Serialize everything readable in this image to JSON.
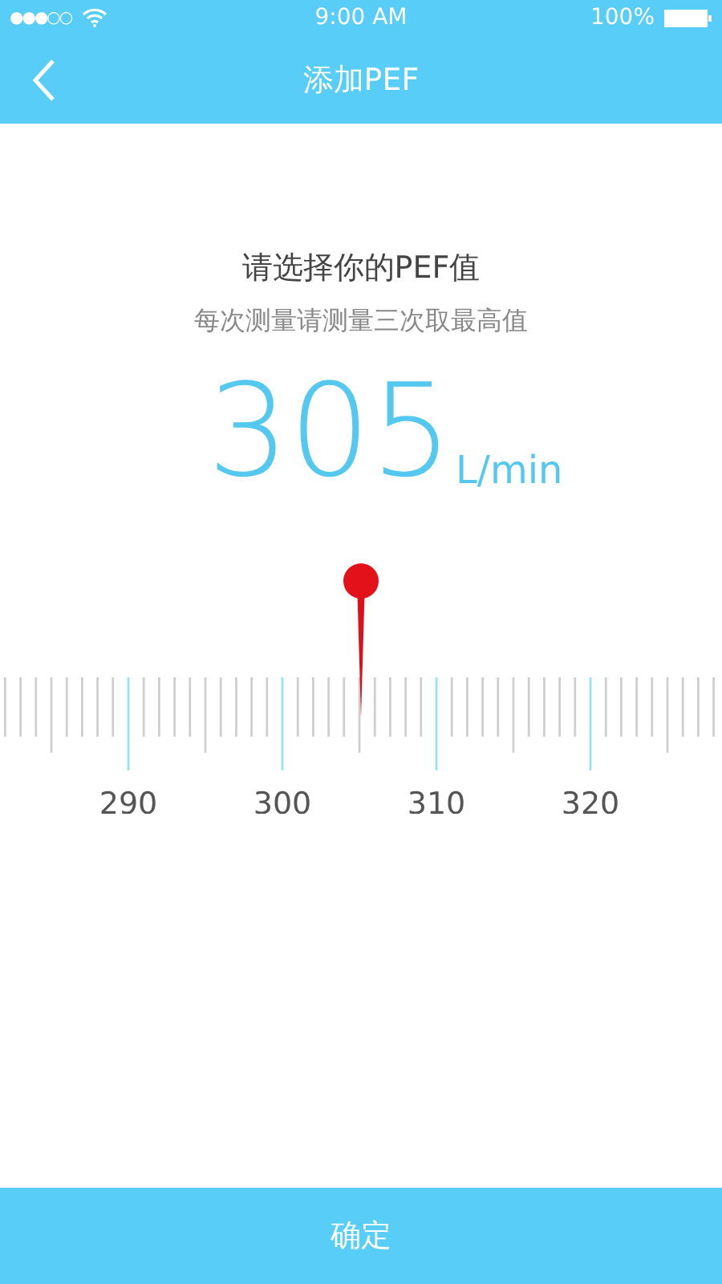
{
  "status_bar": {
    "carrier_signal": "●●●○○",
    "time": "9:00 AM",
    "battery": "100%"
  },
  "nav_bar": {
    "title": "添加PEF"
  },
  "prompt": {
    "title": "请选择你的PEF值",
    "subtitle": "每次测量请测量三次取最高值"
  },
  "reading": {
    "value": "305",
    "unit": "L/min"
  },
  "ruler": {
    "labels": [
      "290",
      "300",
      "310",
      "320"
    ]
  },
  "confirm_button": {
    "label": "确定"
  }
}
